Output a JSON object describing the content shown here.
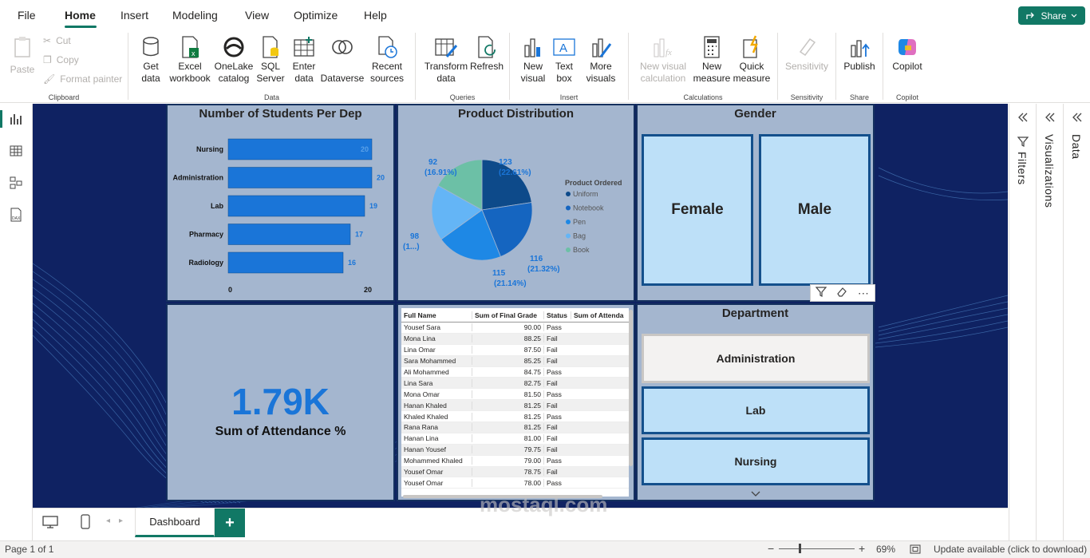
{
  "menu": {
    "tabs": [
      "File",
      "Home",
      "Insert",
      "Modeling",
      "View",
      "Optimize",
      "Help"
    ],
    "share_label": "Share"
  },
  "ribbon": {
    "clipboard": {
      "paste": "Paste",
      "cut": "Cut",
      "copy": "Copy",
      "format_painter": "Format painter",
      "label": "Clipboard"
    },
    "data": {
      "get_data": "Get data",
      "excel": "Excel workbook",
      "onelake": "OneLake catalog",
      "sql": "SQL Server",
      "enter": "Enter data",
      "dataverse": "Dataverse",
      "recent": "Recent sources",
      "label": "Data"
    },
    "queries": {
      "transform": "Transform data",
      "refresh": "Refresh",
      "label": "Queries"
    },
    "insert": {
      "new_visual": "New visual",
      "text_box": "Text box",
      "more_visuals": "More visuals",
      "label": "Insert"
    },
    "calculations": {
      "new_visual_calc": "New visual calculation",
      "new_measure": "New measure",
      "quick_measure": "Quick measure",
      "label": "Calculations"
    },
    "sensitivity": {
      "btn": "Sensitivity",
      "label": "Sensitivity"
    },
    "share": {
      "publish": "Publish",
      "label": "Share"
    },
    "copilot": {
      "btn": "Copilot",
      "label": "Copilot"
    }
  },
  "panes": {
    "filters": "Filters",
    "visualizations": "Visualizations",
    "data": "Data"
  },
  "bar_visual": {
    "title": "Number of Students Per Dep",
    "chart_data": {
      "type": "bar",
      "categories": [
        "Nursing",
        "Administration",
        "Lab",
        "Pharmacy",
        "Radiology"
      ],
      "values": [
        20,
        20,
        19,
        17,
        16
      ],
      "xlim": [
        0,
        20
      ],
      "xticks": [
        "0",
        "20"
      ],
      "color": "#1a75d8"
    }
  },
  "pie_visual": {
    "title": "Product Distribution",
    "legend_title": "Product Ordered",
    "chart_data": {
      "type": "pie",
      "series": [
        {
          "name": "Uniform",
          "value": 123,
          "pct": "22.61%",
          "color": "#0d4a8a"
        },
        {
          "name": "Notebook",
          "value": 116,
          "pct": "21.32%",
          "color": "#1565c0"
        },
        {
          "name": "Pen",
          "value": 115,
          "pct": "21.14%",
          "color": "#1e88e5"
        },
        {
          "name": "Bag",
          "value": 98,
          "pct": "1...",
          "color": "#64b5f6"
        },
        {
          "name": "Book",
          "value": 92,
          "pct": "16.91%",
          "color": "#6cc0a6"
        }
      ]
    },
    "labels": {
      "uniform_v": "123",
      "uniform_p": "(22.61%)",
      "notebook_v": "116",
      "notebook_p": "(21.32%)",
      "pen_v": "115",
      "pen_p": "(21.14%)",
      "bag_v": "98",
      "bag_p": "(1...)",
      "book_v": "92",
      "book_p": "(16.91%)"
    }
  },
  "gender_visual": {
    "title": "Gender",
    "options": [
      "Female",
      "Male"
    ]
  },
  "card_visual": {
    "value": "1.79K",
    "label": "Sum of Attendance %"
  },
  "table_visual": {
    "headers": [
      "Full Name",
      "Sum of Final Grade",
      "Status",
      "Sum of Attenda"
    ],
    "rows": [
      [
        "Yousef Sara",
        "90.00",
        "Pass",
        ""
      ],
      [
        "Mona Lina",
        "88.25",
        "Fail",
        ""
      ],
      [
        "Lina Omar",
        "87.50",
        "Fail",
        ""
      ],
      [
        "Sara Mohammed",
        "85.25",
        "Fail",
        ""
      ],
      [
        "Ali Mohammed",
        "84.75",
        "Pass",
        ""
      ],
      [
        "Lina Sara",
        "82.75",
        "Fail",
        ""
      ],
      [
        "Mona Omar",
        "81.50",
        "Pass",
        ""
      ],
      [
        "Hanan Khaled",
        "81.25",
        "Fail",
        ""
      ],
      [
        "Khaled Khaled",
        "81.25",
        "Pass",
        ""
      ],
      [
        "Rana Rana",
        "81.25",
        "Fail",
        ""
      ],
      [
        "Hanan Lina",
        "81.00",
        "Fail",
        ""
      ],
      [
        "Hanan Yousef",
        "79.75",
        "Fail",
        ""
      ],
      [
        "Mohammed Khaled",
        "79.00",
        "Pass",
        ""
      ],
      [
        "Yousef Omar",
        "78.75",
        "Fail",
        ""
      ],
      [
        "Yousef Omar",
        "78.00",
        "Pass",
        ""
      ]
    ]
  },
  "department_visual": {
    "title": "Department",
    "options": [
      "Administration",
      "Lab",
      "Nursing"
    ]
  },
  "pages": {
    "tab": "Dashboard",
    "add": "+"
  },
  "status": {
    "page": "Page 1 of 1",
    "zoom": "69%",
    "update": "Update available (click to download)"
  },
  "watermark": {
    "text": "mostaql.com"
  },
  "colors": {
    "accent": "#117865",
    "canvas_bg": "#0f2262",
    "visual_bg": "#a4b6cf",
    "bar": "#1a75d8"
  }
}
